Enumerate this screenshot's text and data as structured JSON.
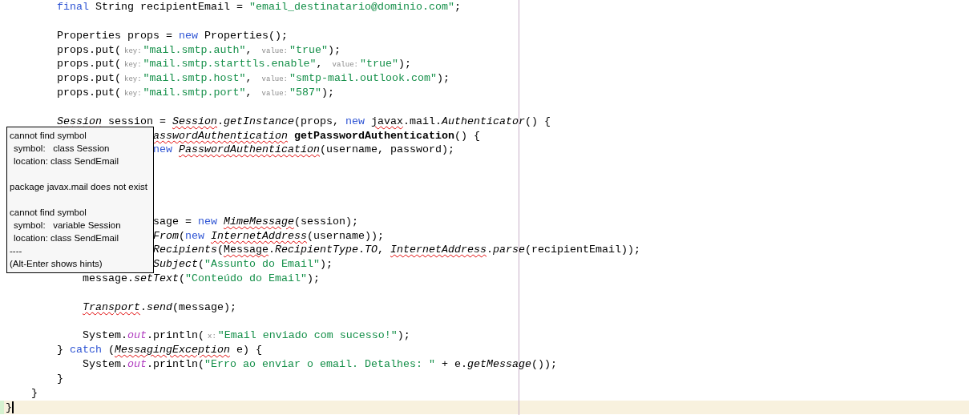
{
  "editor": {
    "lines": [
      {
        "kind": "code",
        "tokens": [
          {
            "kind": "keyword",
            "text": "        final"
          },
          {
            "kind": "plain",
            "text": " String recipientEmail = "
          },
          {
            "kind": "string",
            "text": "\"email_destinatario@dominio.com\""
          },
          {
            "kind": "plain",
            "text": ";"
          }
        ]
      },
      {
        "kind": "blank"
      },
      {
        "kind": "code",
        "tokens": [
          {
            "kind": "plain",
            "text": "        Properties props = "
          },
          {
            "kind": "keyword",
            "text": "new"
          },
          {
            "kind": "plain",
            "text": " Properties();"
          }
        ]
      },
      {
        "kind": "code",
        "tokens": [
          {
            "kind": "plain",
            "text": "        props.put("
          },
          {
            "kind": "hint",
            "text": "key:"
          },
          {
            "kind": "string",
            "text": "\"mail.smtp.auth\""
          },
          {
            "kind": "plain",
            "text": ", "
          },
          {
            "kind": "hint",
            "text": "value:"
          },
          {
            "kind": "string",
            "text": "\"true\""
          },
          {
            "kind": "plain",
            "text": ");"
          }
        ]
      },
      {
        "kind": "code",
        "tokens": [
          {
            "kind": "plain",
            "text": "        props.put("
          },
          {
            "kind": "hint",
            "text": "key:"
          },
          {
            "kind": "string",
            "text": "\"mail.smtp.starttls.enable\""
          },
          {
            "kind": "plain",
            "text": ", "
          },
          {
            "kind": "hint",
            "text": "value:"
          },
          {
            "kind": "string",
            "text": "\"true\""
          },
          {
            "kind": "plain",
            "text": ");"
          }
        ]
      },
      {
        "kind": "code",
        "tokens": [
          {
            "kind": "plain",
            "text": "        props.put("
          },
          {
            "kind": "hint",
            "text": "key:"
          },
          {
            "kind": "string",
            "text": "\"mail.smtp.host\""
          },
          {
            "kind": "plain",
            "text": ", "
          },
          {
            "kind": "hint",
            "text": "value:"
          },
          {
            "kind": "string",
            "text": "\"smtp-mail.outlook.com\""
          },
          {
            "kind": "plain",
            "text": ");"
          }
        ]
      },
      {
        "kind": "code",
        "tokens": [
          {
            "kind": "plain",
            "text": "        props.put("
          },
          {
            "kind": "hint",
            "text": "key:"
          },
          {
            "kind": "string",
            "text": "\"mail.smtp.port\""
          },
          {
            "kind": "plain",
            "text": ", "
          },
          {
            "kind": "hint",
            "text": "value:"
          },
          {
            "kind": "string",
            "text": "\"587\""
          },
          {
            "kind": "plain",
            "text": ");"
          }
        ]
      },
      {
        "kind": "blank"
      },
      {
        "kind": "code",
        "tokens": [
          {
            "kind": "error_italic",
            "text": "        Session"
          },
          {
            "kind": "plain",
            "text": " session = "
          },
          {
            "kind": "error_italic",
            "text": "Session"
          },
          {
            "kind": "plain",
            "text": "."
          },
          {
            "kind": "italic",
            "text": "getInstance"
          },
          {
            "kind": "plain",
            "text": "(props, "
          },
          {
            "kind": "keyword",
            "text": "new "
          },
          {
            "kind": "error",
            "text": "javax"
          },
          {
            "kind": "plain",
            "text": ".mail."
          },
          {
            "kind": "italic",
            "text": "Authenticator"
          },
          {
            "kind": "plain",
            "text": "() {"
          }
        ]
      },
      {
        "kind": "code",
        "tokens": [
          {
            "kind": "error_italic",
            "text": "                       asswordAuthentication"
          },
          {
            "kind": "bold",
            "text": " getPasswordAuthentication"
          },
          {
            "kind": "plain",
            "text": "() {"
          }
        ]
      },
      {
        "kind": "code",
        "tokens": [
          {
            "kind": "keyword",
            "text": "                       new "
          },
          {
            "kind": "error_italic",
            "text": "PasswordAuthentication"
          },
          {
            "kind": "plain",
            "text": "(username, password);"
          }
        ]
      },
      {
        "kind": "blank"
      },
      {
        "kind": "blank"
      },
      {
        "kind": "blank"
      },
      {
        "kind": "blank"
      },
      {
        "kind": "code",
        "tokens": [
          {
            "kind": "plain",
            "text": "                       sage = "
          },
          {
            "kind": "keyword",
            "text": "new "
          },
          {
            "kind": "error_italic",
            "text": "MimeMessage"
          },
          {
            "kind": "plain",
            "text": "(session);"
          }
        ]
      },
      {
        "kind": "code",
        "tokens": [
          {
            "kind": "italic",
            "text": "                       From"
          },
          {
            "kind": "plain",
            "text": "("
          },
          {
            "kind": "keyword",
            "text": "new "
          },
          {
            "kind": "error_italic",
            "text": "InternetAddress"
          },
          {
            "kind": "plain",
            "text": "(username));"
          }
        ]
      },
      {
        "kind": "code",
        "tokens": [
          {
            "kind": "italic",
            "text": "                       Recipients"
          },
          {
            "kind": "plain",
            "text": "("
          },
          {
            "kind": "error",
            "text": "Message"
          },
          {
            "kind": "plain",
            "text": "."
          },
          {
            "kind": "italic",
            "text": "RecipientType"
          },
          {
            "kind": "plain",
            "text": "."
          },
          {
            "kind": "italic",
            "text": "TO"
          },
          {
            "kind": "plain",
            "text": ", "
          },
          {
            "kind": "error_italic",
            "text": "InternetAddress"
          },
          {
            "kind": "plain",
            "text": "."
          },
          {
            "kind": "italic",
            "text": "parse"
          },
          {
            "kind": "plain",
            "text": "(recipientEmail));"
          }
        ]
      },
      {
        "kind": "code",
        "tokens": [
          {
            "kind": "italic",
            "text": "                       Subject"
          },
          {
            "kind": "plain",
            "text": "("
          },
          {
            "kind": "string",
            "text": "\"Assunto do Email\""
          },
          {
            "kind": "plain",
            "text": ");"
          }
        ]
      },
      {
        "kind": "code",
        "tokens": [
          {
            "kind": "plain",
            "text": "            message."
          },
          {
            "kind": "italic",
            "text": "setText"
          },
          {
            "kind": "plain",
            "text": "("
          },
          {
            "kind": "string",
            "text": "\"Conteúdo do Email\""
          },
          {
            "kind": "plain",
            "text": ");"
          }
        ]
      },
      {
        "kind": "blank"
      },
      {
        "kind": "code",
        "tokens": [
          {
            "kind": "error_italic",
            "text": "            Transport"
          },
          {
            "kind": "plain",
            "text": "."
          },
          {
            "kind": "italic",
            "text": "send"
          },
          {
            "kind": "plain",
            "text": "(message);"
          }
        ]
      },
      {
        "kind": "blank"
      },
      {
        "kind": "code",
        "tokens": [
          {
            "kind": "plain",
            "text": "            System."
          },
          {
            "kind": "field",
            "text": "out"
          },
          {
            "kind": "plain",
            "text": ".println("
          },
          {
            "kind": "hint",
            "text": "x:"
          },
          {
            "kind": "string",
            "text": "\"Email enviado com sucesso!\""
          },
          {
            "kind": "plain",
            "text": ");"
          }
        ]
      },
      {
        "kind": "code",
        "tokens": [
          {
            "kind": "plain",
            "text": "        } "
          },
          {
            "kind": "keyword",
            "text": "catch"
          },
          {
            "kind": "plain",
            "text": " ("
          },
          {
            "kind": "error_italic",
            "text": "MessagingException"
          },
          {
            "kind": "plain",
            "text": " e) {"
          }
        ]
      },
      {
        "kind": "code",
        "tokens": [
          {
            "kind": "plain",
            "text": "            System."
          },
          {
            "kind": "field",
            "text": "out"
          },
          {
            "kind": "plain",
            "text": ".println("
          },
          {
            "kind": "string",
            "text": "\"Erro ao enviar o email. Detalhes: \""
          },
          {
            "kind": "plain",
            "text": " + e."
          },
          {
            "kind": "italic",
            "text": "getMessage"
          },
          {
            "kind": "plain",
            "text": "());"
          }
        ]
      },
      {
        "kind": "code",
        "tokens": [
          {
            "kind": "plain",
            "text": "        }"
          }
        ]
      },
      {
        "kind": "code",
        "tokens": [
          {
            "kind": "plain",
            "text": "    }"
          }
        ]
      },
      {
        "kind": "current",
        "tokens": [
          {
            "kind": "plain",
            "text": "}"
          }
        ]
      }
    ]
  },
  "tooltip": {
    "messages": [
      {
        "title": "cannot find symbol",
        "details": [
          "symbol:   class Session",
          "location: class SendEmail"
        ]
      },
      {
        "title": "package javax.mail does not exist"
      },
      {
        "title": "cannot find symbol",
        "details": [
          "symbol:   variable Session",
          "location: class SendEmail"
        ]
      }
    ],
    "footer": [
      "----",
      "(Alt-Enter shows hints)"
    ]
  }
}
